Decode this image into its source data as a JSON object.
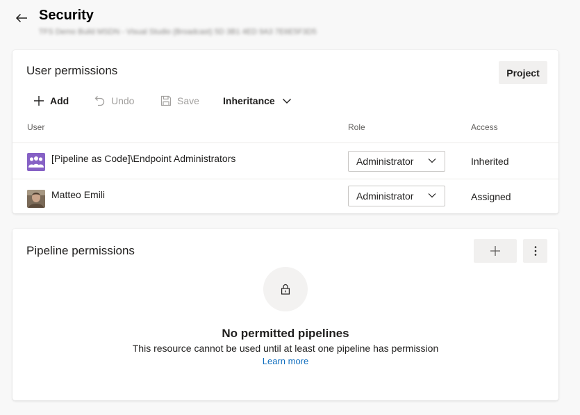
{
  "header": {
    "title": "Security",
    "subtitle": "TFS Demo Build MSDN - Visual Studio (Broadcast) 5D 3B1 4ED 9A3 7E6E5F3D5"
  },
  "user_permissions": {
    "title": "User permissions",
    "project_button": "Project",
    "toolbar": {
      "add": "Add",
      "undo": "Undo",
      "save": "Save",
      "inheritance": "Inheritance"
    },
    "columns": {
      "user": "User",
      "role": "Role",
      "access": "Access"
    },
    "rows": [
      {
        "user": "[Pipeline as Code]\\Endpoint Administrators",
        "role": "Administrator",
        "access": "Inherited",
        "avatar": "group-icon"
      },
      {
        "user": "Matteo Emili",
        "role": "Administrator",
        "access": "Assigned",
        "avatar": "user-photo"
      }
    ]
  },
  "pipeline_permissions": {
    "title": "Pipeline permissions",
    "empty_title": "No permitted pipelines",
    "empty_description": "This resource cannot be used until at least one pipeline has permission",
    "learn_more": "Learn more"
  },
  "colors": {
    "link": "#106ebe",
    "group_avatar": "#8661c5",
    "button_bg": "#f1f0ef"
  }
}
